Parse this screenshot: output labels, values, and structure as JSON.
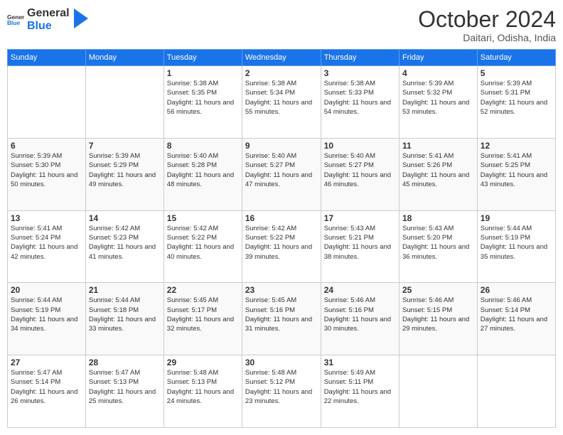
{
  "header": {
    "logo_general": "General",
    "logo_blue": "Blue",
    "month": "October 2024",
    "location": "Daitari, Odisha, India"
  },
  "weekdays": [
    "Sunday",
    "Monday",
    "Tuesday",
    "Wednesday",
    "Thursday",
    "Friday",
    "Saturday"
  ],
  "weeks": [
    [
      {
        "day": "",
        "sunrise": "",
        "sunset": "",
        "daylight": ""
      },
      {
        "day": "",
        "sunrise": "",
        "sunset": "",
        "daylight": ""
      },
      {
        "day": "1",
        "sunrise": "Sunrise: 5:38 AM",
        "sunset": "Sunset: 5:35 PM",
        "daylight": "Daylight: 11 hours and 56 minutes."
      },
      {
        "day": "2",
        "sunrise": "Sunrise: 5:38 AM",
        "sunset": "Sunset: 5:34 PM",
        "daylight": "Daylight: 11 hours and 55 minutes."
      },
      {
        "day": "3",
        "sunrise": "Sunrise: 5:38 AM",
        "sunset": "Sunset: 5:33 PM",
        "daylight": "Daylight: 11 hours and 54 minutes."
      },
      {
        "day": "4",
        "sunrise": "Sunrise: 5:39 AM",
        "sunset": "Sunset: 5:32 PM",
        "daylight": "Daylight: 11 hours and 53 minutes."
      },
      {
        "day": "5",
        "sunrise": "Sunrise: 5:39 AM",
        "sunset": "Sunset: 5:31 PM",
        "daylight": "Daylight: 11 hours and 52 minutes."
      }
    ],
    [
      {
        "day": "6",
        "sunrise": "Sunrise: 5:39 AM",
        "sunset": "Sunset: 5:30 PM",
        "daylight": "Daylight: 11 hours and 50 minutes."
      },
      {
        "day": "7",
        "sunrise": "Sunrise: 5:39 AM",
        "sunset": "Sunset: 5:29 PM",
        "daylight": "Daylight: 11 hours and 49 minutes."
      },
      {
        "day": "8",
        "sunrise": "Sunrise: 5:40 AM",
        "sunset": "Sunset: 5:28 PM",
        "daylight": "Daylight: 11 hours and 48 minutes."
      },
      {
        "day": "9",
        "sunrise": "Sunrise: 5:40 AM",
        "sunset": "Sunset: 5:27 PM",
        "daylight": "Daylight: 11 hours and 47 minutes."
      },
      {
        "day": "10",
        "sunrise": "Sunrise: 5:40 AM",
        "sunset": "Sunset: 5:27 PM",
        "daylight": "Daylight: 11 hours and 46 minutes."
      },
      {
        "day": "11",
        "sunrise": "Sunrise: 5:41 AM",
        "sunset": "Sunset: 5:26 PM",
        "daylight": "Daylight: 11 hours and 45 minutes."
      },
      {
        "day": "12",
        "sunrise": "Sunrise: 5:41 AM",
        "sunset": "Sunset: 5:25 PM",
        "daylight": "Daylight: 11 hours and 43 minutes."
      }
    ],
    [
      {
        "day": "13",
        "sunrise": "Sunrise: 5:41 AM",
        "sunset": "Sunset: 5:24 PM",
        "daylight": "Daylight: 11 hours and 42 minutes."
      },
      {
        "day": "14",
        "sunrise": "Sunrise: 5:42 AM",
        "sunset": "Sunset: 5:23 PM",
        "daylight": "Daylight: 11 hours and 41 minutes."
      },
      {
        "day": "15",
        "sunrise": "Sunrise: 5:42 AM",
        "sunset": "Sunset: 5:22 PM",
        "daylight": "Daylight: 11 hours and 40 minutes."
      },
      {
        "day": "16",
        "sunrise": "Sunrise: 5:42 AM",
        "sunset": "Sunset: 5:22 PM",
        "daylight": "Daylight: 11 hours and 39 minutes."
      },
      {
        "day": "17",
        "sunrise": "Sunrise: 5:43 AM",
        "sunset": "Sunset: 5:21 PM",
        "daylight": "Daylight: 11 hours and 38 minutes."
      },
      {
        "day": "18",
        "sunrise": "Sunrise: 5:43 AM",
        "sunset": "Sunset: 5:20 PM",
        "daylight": "Daylight: 11 hours and 36 minutes."
      },
      {
        "day": "19",
        "sunrise": "Sunrise: 5:44 AM",
        "sunset": "Sunset: 5:19 PM",
        "daylight": "Daylight: 11 hours and 35 minutes."
      }
    ],
    [
      {
        "day": "20",
        "sunrise": "Sunrise: 5:44 AM",
        "sunset": "Sunset: 5:19 PM",
        "daylight": "Daylight: 11 hours and 34 minutes."
      },
      {
        "day": "21",
        "sunrise": "Sunrise: 5:44 AM",
        "sunset": "Sunset: 5:18 PM",
        "daylight": "Daylight: 11 hours and 33 minutes."
      },
      {
        "day": "22",
        "sunrise": "Sunrise: 5:45 AM",
        "sunset": "Sunset: 5:17 PM",
        "daylight": "Daylight: 11 hours and 32 minutes."
      },
      {
        "day": "23",
        "sunrise": "Sunrise: 5:45 AM",
        "sunset": "Sunset: 5:16 PM",
        "daylight": "Daylight: 11 hours and 31 minutes."
      },
      {
        "day": "24",
        "sunrise": "Sunrise: 5:46 AM",
        "sunset": "Sunset: 5:16 PM",
        "daylight": "Daylight: 11 hours and 30 minutes."
      },
      {
        "day": "25",
        "sunrise": "Sunrise: 5:46 AM",
        "sunset": "Sunset: 5:15 PM",
        "daylight": "Daylight: 11 hours and 29 minutes."
      },
      {
        "day": "26",
        "sunrise": "Sunrise: 5:46 AM",
        "sunset": "Sunset: 5:14 PM",
        "daylight": "Daylight: 11 hours and 27 minutes."
      }
    ],
    [
      {
        "day": "27",
        "sunrise": "Sunrise: 5:47 AM",
        "sunset": "Sunset: 5:14 PM",
        "daylight": "Daylight: 11 hours and 26 minutes."
      },
      {
        "day": "28",
        "sunrise": "Sunrise: 5:47 AM",
        "sunset": "Sunset: 5:13 PM",
        "daylight": "Daylight: 11 hours and 25 minutes."
      },
      {
        "day": "29",
        "sunrise": "Sunrise: 5:48 AM",
        "sunset": "Sunset: 5:13 PM",
        "daylight": "Daylight: 11 hours and 24 minutes."
      },
      {
        "day": "30",
        "sunrise": "Sunrise: 5:48 AM",
        "sunset": "Sunset: 5:12 PM",
        "daylight": "Daylight: 11 hours and 23 minutes."
      },
      {
        "day": "31",
        "sunrise": "Sunrise: 5:49 AM",
        "sunset": "Sunset: 5:11 PM",
        "daylight": "Daylight: 11 hours and 22 minutes."
      },
      {
        "day": "",
        "sunrise": "",
        "sunset": "",
        "daylight": ""
      },
      {
        "day": "",
        "sunrise": "",
        "sunset": "",
        "daylight": ""
      }
    ]
  ]
}
